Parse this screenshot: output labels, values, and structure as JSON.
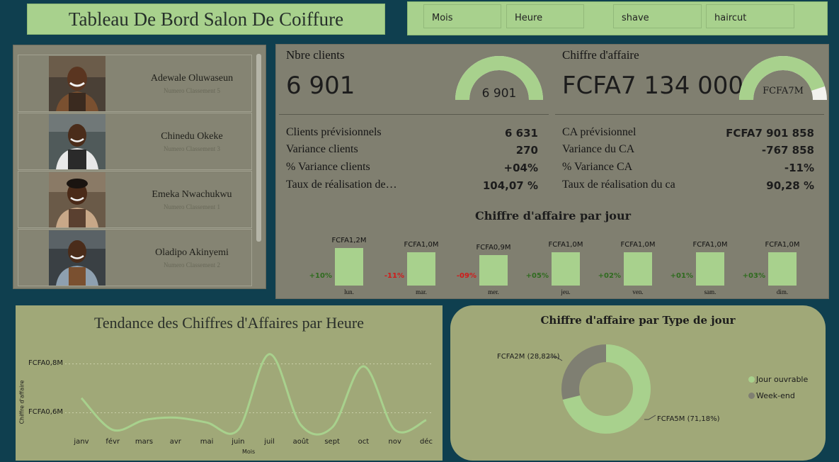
{
  "header": {
    "title": "Tableau De Bord Salon De Coiffure",
    "filters": [
      "Mois",
      "Heure",
      "shave",
      "haircut"
    ]
  },
  "barbers": [
    {
      "name": "Adewale Oluwaseun",
      "rank": "Numero Classement 5"
    },
    {
      "name": "Chinedu Okeke",
      "rank": "Numero Classement 3"
    },
    {
      "name": "Emeka Nwachukwu",
      "rank": "Numero Classement 1"
    },
    {
      "name": "Oladipo Akinyemi",
      "rank": "Numero Classement 2"
    }
  ],
  "kpi_clients": {
    "title": "Nbre clients",
    "value": "6 901",
    "gauge_label": "6 901",
    "gauge_fraction": 1.0,
    "metrics": [
      {
        "label": "Clients prévisionnels",
        "value": "6 631"
      },
      {
        "label": "Variance clients",
        "value": "270"
      },
      {
        "label": "% Variance clients",
        "value": "+04%"
      },
      {
        "label": "Taux de réalisation de…",
        "value": "104,07 %"
      }
    ]
  },
  "kpi_ca": {
    "title": "Chiffre d'affaire",
    "value": "FCFA7 134 000",
    "gauge_label": "FCFA7M",
    "gauge_fraction": 0.9,
    "metrics": [
      {
        "label": "CA prévisionnel",
        "value": "FCFA7 901 858"
      },
      {
        "label": "Variance du CA",
        "value": "-767 858"
      },
      {
        "label": "% Variance CA",
        "value": "-11%"
      },
      {
        "label": "Taux de réalisation du ca",
        "value": "90,28 %"
      }
    ]
  },
  "daily_chart": {
    "title": "Chiffre d'affaire par jour",
    "days": [
      {
        "day": "lun.",
        "value_label": "FCFA1,2M",
        "variance": "+10%"
      },
      {
        "day": "mar.",
        "value_label": "FCFA1,0M",
        "variance": "-11%"
      },
      {
        "day": "mer.",
        "value_label": "FCFA0,9M",
        "variance": "-09%"
      },
      {
        "day": "jeu.",
        "value_label": "FCFA1,0M",
        "variance": "+05%"
      },
      {
        "day": "ven.",
        "value_label": "FCFA1,0M",
        "variance": "+02%"
      },
      {
        "day": "sam.",
        "value_label": "FCFA1,0M",
        "variance": "+01%"
      },
      {
        "day": "dim.",
        "value_label": "FCFA1,0M",
        "variance": "+03%"
      }
    ]
  },
  "colors": {
    "accent": "#a8d18d",
    "gray_slice": "#7f7f72",
    "positive": "#2f6b1f",
    "negative": "#d11a1a",
    "background": "#0f3f4f"
  },
  "chart_data": [
    {
      "type": "bar",
      "title": "Chiffre d'affaire par jour",
      "categories": [
        "lun.",
        "mar.",
        "mer.",
        "jeu.",
        "ven.",
        "sam.",
        "dim."
      ],
      "values": [
        1.2,
        1.0,
        0.9,
        1.0,
        1.0,
        1.0,
        1.0
      ],
      "labels": [
        "FCFA1,2M",
        "FCFA1,0M",
        "FCFA0,9M",
        "FCFA1,0M",
        "FCFA1,0M",
        "FCFA1,0M",
        "FCFA1,0M"
      ],
      "variance": [
        "+10%",
        "-11%",
        "-09%",
        "+05%",
        "+02%",
        "+01%",
        "+03%"
      ]
    },
    {
      "type": "line",
      "title": "Tendance des Chiffres d'Affaires par Heure",
      "xlabel": "Mois",
      "ylabel": "Chiffre d'affaire",
      "categories": [
        "janv",
        "févr",
        "mars",
        "avr",
        "mai",
        "juin",
        "juil",
        "août",
        "sept",
        "oct",
        "nov",
        "déc"
      ],
      "values": [
        0.66,
        0.53,
        0.57,
        0.58,
        0.56,
        0.53,
        0.84,
        0.55,
        0.54,
        0.79,
        0.53,
        0.57
      ],
      "yticks": [
        {
          "value": 0.6,
          "label": "FCFA0,6M"
        },
        {
          "value": 0.8,
          "label": "FCFA0,8M"
        }
      ],
      "ylim": [
        0.5,
        0.9
      ],
      "grid": true
    },
    {
      "type": "pie",
      "title": "Chiffre d'affaire par Type de jour",
      "slices": [
        {
          "name": "Jour ouvrable",
          "value": 71.18,
          "label": "FCFA5M (71,18%)",
          "color": "#a8d18d"
        },
        {
          "name": "Week-end",
          "value": 28.82,
          "label": "FCFA2M (28,82%)",
          "color": "#7f7f72"
        }
      ],
      "legend": "right"
    }
  ]
}
